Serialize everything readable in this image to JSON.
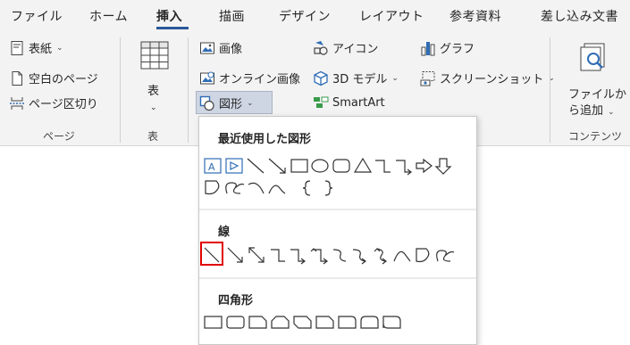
{
  "tabs": [
    "ファイル",
    "ホーム",
    "挿入",
    "描画",
    "デザイン",
    "レイアウト",
    "参考資料",
    "差し込み文書"
  ],
  "active_tab": "挿入",
  "ribbon": {
    "pages_group": {
      "cover": "表紙",
      "blank_page": "空白のページ",
      "page_break": "ページ区切り",
      "label": "ページ"
    },
    "table_group": {
      "table": "表",
      "label": "表"
    },
    "illustrations": {
      "picture": "画像",
      "online_picture": "オンライン画像",
      "shapes": "図形",
      "icons": "アイコン",
      "models_3d": "3D モデル",
      "smartart": "SmartArt",
      "chart": "グラフ",
      "screenshot": "スクリーンショット"
    },
    "content_group": {
      "add_from_file_line1": "ファイルか",
      "add_from_file_line2": "ら追加",
      "label": "コンテンツ"
    }
  },
  "shapes_panel": {
    "recent": "最近使用した図形",
    "lines": "線",
    "rectangles": "四角形"
  },
  "colors": {
    "ribbon_bg": "#f3f3f3",
    "accent_blue": "#2b579a",
    "highlight_red": "#e00000",
    "icon_blue": "#2f6db5"
  }
}
